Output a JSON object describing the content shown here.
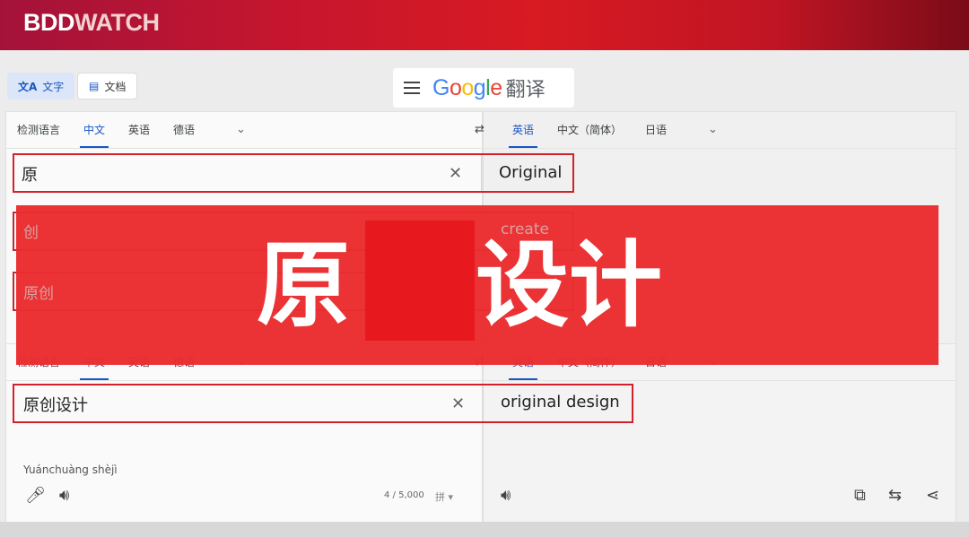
{
  "brand": {
    "part1": "BDD",
    "part2": "WATCH"
  },
  "toolbar": {
    "text_chip": "文字",
    "doc_chip": "文档",
    "logo": "Google",
    "logo_suffix": "翻译"
  },
  "source_langs": [
    "检测语言",
    "中文",
    "英语",
    "德语"
  ],
  "target_langs": [
    "英语",
    "中文（简体）",
    "日语"
  ],
  "rows": [
    {
      "source": "原",
      "target": "Original"
    },
    {
      "source": "创",
      "target": "create"
    },
    {
      "source": "原创",
      "target": ""
    }
  ],
  "bottom": {
    "source_langs": [
      "检测语言",
      "中文",
      "英语",
      "德语"
    ],
    "target_langs": [
      "英语",
      "中文（简体）",
      "日语"
    ],
    "source": "原创设计",
    "target": "original design",
    "pinyin": "Yuánchuàng shèjì",
    "counter": "4 / 5,000",
    "ime": "拼"
  },
  "banner": {
    "char1": "原",
    "char2": "设计"
  },
  "colors": {
    "accent": "#1a56c4",
    "highlight": "#d3212b",
    "banner": "#ea2c2f"
  }
}
